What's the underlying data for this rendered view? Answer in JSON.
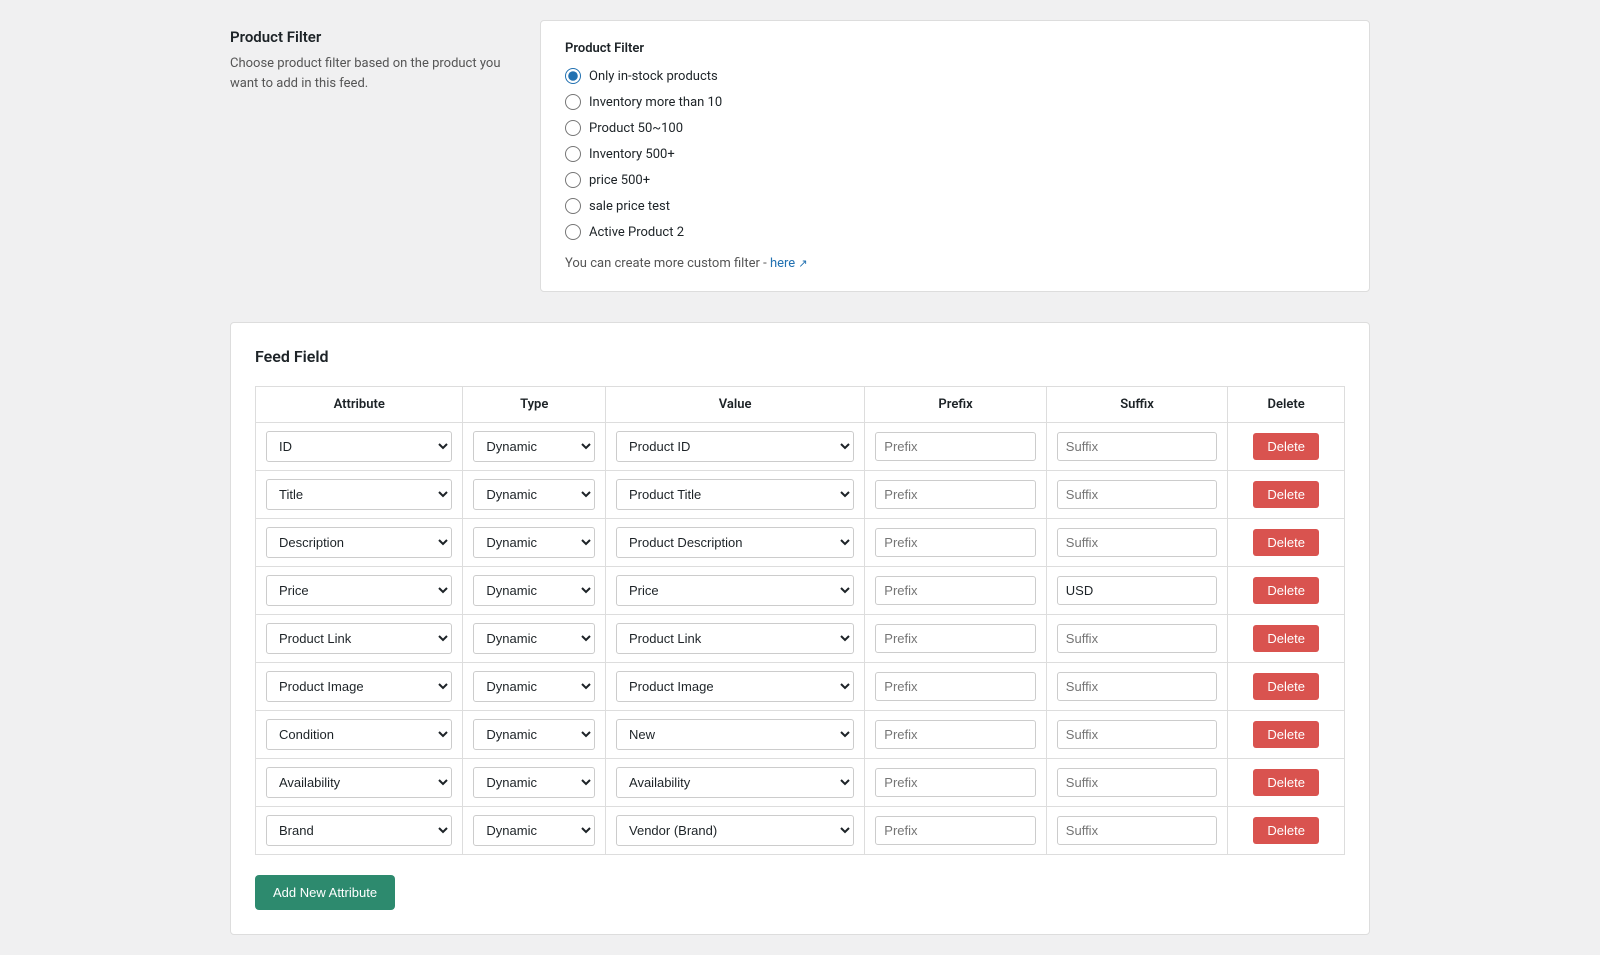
{
  "productFilter": {
    "leftTitle": "Product Filter",
    "leftDescription": "Choose product filter based on the product you want to add in this feed.",
    "rightTitle": "Product Filter",
    "options": [
      {
        "id": "opt1",
        "label": "Only in-stock products",
        "checked": true
      },
      {
        "id": "opt2",
        "label": "Inventory more than 10",
        "checked": false
      },
      {
        "id": "opt3",
        "label": "Product 50~100",
        "checked": false
      },
      {
        "id": "opt4",
        "label": "Inventory 500+",
        "checked": false
      },
      {
        "id": "opt5",
        "label": "price 500+",
        "checked": false
      },
      {
        "id": "opt6",
        "label": "sale price test",
        "checked": false
      },
      {
        "id": "opt7",
        "label": "Active Product 2",
        "checked": false
      }
    ],
    "customFilterText": "You can create more custom filter -",
    "customFilterLinkLabel": "here",
    "customFilterLinkHref": "#"
  },
  "feedField": {
    "title": "Feed Field",
    "columns": {
      "attribute": "Attribute",
      "type": "Type",
      "value": "Value",
      "prefix": "Prefix",
      "suffix": "Suffix",
      "delete": "Delete"
    },
    "rows": [
      {
        "attribute": "ID",
        "type": "Dynamic",
        "value": "Product ID",
        "prefix": "",
        "prefixPlaceholder": "Prefix",
        "suffix": "",
        "suffixPlaceholder": "Suffix"
      },
      {
        "attribute": "Title",
        "type": "Dynamic",
        "value": "Product Title",
        "prefix": "",
        "prefixPlaceholder": "Prefix",
        "suffix": "",
        "suffixPlaceholder": "Suffix"
      },
      {
        "attribute": "Description",
        "type": "Dynamic",
        "value": "Product Description",
        "prefix": "",
        "prefixPlaceholder": "Prefix",
        "suffix": "",
        "suffixPlaceholder": "Suffix"
      },
      {
        "attribute": "Price",
        "type": "Dynamic",
        "value": "Price",
        "prefix": "",
        "prefixPlaceholder": "Prefix",
        "suffix": "USD",
        "suffixPlaceholder": "Suffix"
      },
      {
        "attribute": "Product Link",
        "type": "Dynamic",
        "value": "Product Link",
        "prefix": "",
        "prefixPlaceholder": "Prefix",
        "suffix": "",
        "suffixPlaceholder": "Suffix"
      },
      {
        "attribute": "Product Image",
        "type": "Dynamic",
        "value": "Product Image",
        "prefix": "",
        "prefixPlaceholder": "Prefix",
        "suffix": "",
        "suffixPlaceholder": "Suffix"
      },
      {
        "attribute": "Condition",
        "type": "Dynamic",
        "value": "New",
        "prefix": "",
        "prefixPlaceholder": "Prefix",
        "suffix": "",
        "suffixPlaceholder": "Suffix"
      },
      {
        "attribute": "Availability",
        "type": "Dynamic",
        "value": "Availability",
        "prefix": "",
        "prefixPlaceholder": "Prefix",
        "suffix": "",
        "suffixPlaceholder": "Suffix"
      },
      {
        "attribute": "Brand",
        "type": "Dynamic",
        "value": "Vendor (Brand)",
        "prefix": "",
        "prefixPlaceholder": "Prefix",
        "suffix": "",
        "suffixPlaceholder": "Suffix"
      }
    ],
    "deleteLabel": "Delete",
    "addNewAttributeLabel": "Add New Attribute"
  }
}
